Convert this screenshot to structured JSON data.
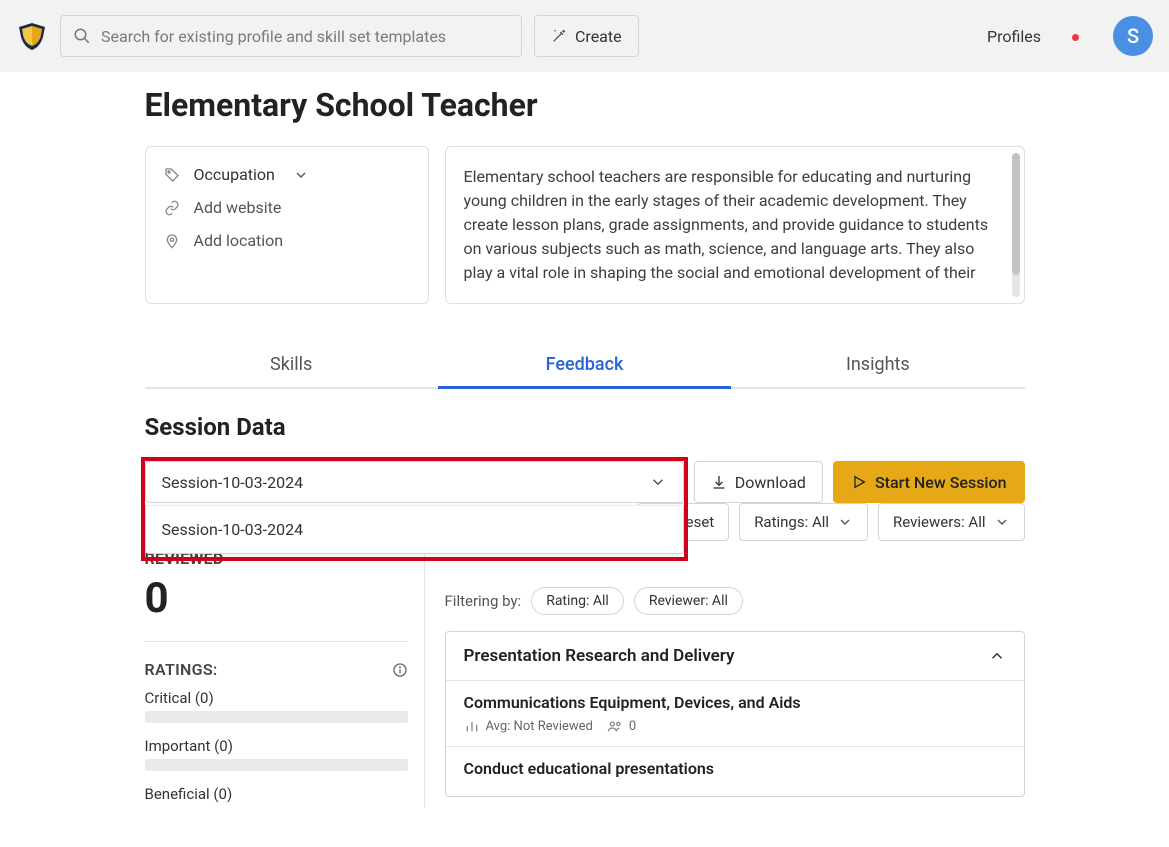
{
  "header": {
    "search_placeholder": "Search for existing profile and skill set templates",
    "create_label": "Create",
    "profiles_link": "Profiles",
    "avatar_initial": "S"
  },
  "page_title": "Elementary School Teacher",
  "meta": {
    "occupation_label": "Occupation",
    "add_website": "Add website",
    "add_location": "Add location"
  },
  "description": "Elementary school teachers are responsible for educating and nurturing young children in the early stages of their academic development. They create lesson plans, grade assignments, and provide guidance to students on various subjects such as math, science, and language arts. They also play a vital role in shaping the social and emotional development of their",
  "tabs": [
    "Skills",
    "Feedback",
    "Insights"
  ],
  "active_tab_index": 1,
  "section_heading": "Session Data",
  "session": {
    "selected": "Session-10-03-2024",
    "options": [
      "Session-10-03-2024"
    ],
    "download_label": "Download",
    "start_new_label": "Start New Session"
  },
  "filters": {
    "reset_label": "Reset",
    "ratings_pill": "Ratings: All",
    "reviewers_pill": "Reviewers: All",
    "filtering_by_label": "Filtering by:",
    "chip_rating": "Rating: All",
    "chip_reviewer": "Reviewer: All"
  },
  "left_panel": {
    "reviewed_label": "REVIEWED",
    "reviewed_count": "0",
    "ratings_label": "RATINGS:",
    "ratings": [
      {
        "label": "Critical (0)"
      },
      {
        "label": "Important (0)"
      },
      {
        "label": "Beneficial (0)"
      }
    ]
  },
  "accordion": {
    "header": "Presentation Research and Delivery",
    "items": [
      {
        "title": "Communications Equipment, Devices, and Aids",
        "avg_label": "Avg: Not Reviewed",
        "count": "0"
      },
      {
        "title": "Conduct educational presentations",
        "avg_label": "",
        "count": ""
      }
    ]
  },
  "colors": {
    "accent_blue": "#2962d9",
    "accent_gold": "#e6a817",
    "highlight_red": "#d0021b"
  }
}
